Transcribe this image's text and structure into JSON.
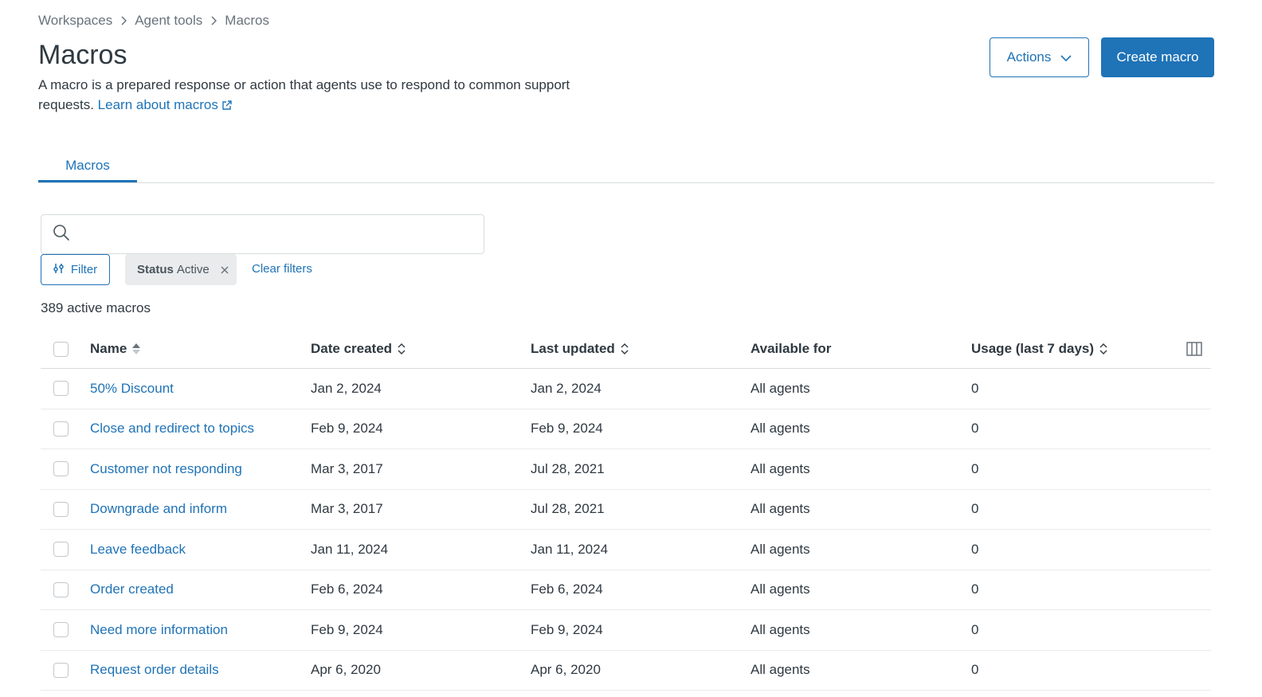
{
  "breadcrumb": {
    "items": [
      "Workspaces",
      "Agent tools",
      "Macros"
    ]
  },
  "header": {
    "title": "Macros",
    "description": "A macro is a prepared response or action that agents use to respond to common support requests.",
    "learn_link": "Learn about macros",
    "actions_label": "Actions",
    "create_label": "Create macro"
  },
  "tabs": [
    {
      "label": "Macros",
      "active": true
    }
  ],
  "search": {
    "value": "",
    "placeholder": ""
  },
  "filters": {
    "filter_label": "Filter",
    "chip_key": "Status",
    "chip_value": "Active",
    "clear_label": "Clear filters"
  },
  "count_text": "389 active macros",
  "table": {
    "headers": {
      "name": "Name",
      "created": "Date created",
      "updated": "Last updated",
      "available": "Available for",
      "usage": "Usage (last 7 days)"
    },
    "rows": [
      {
        "name": "50% Discount",
        "created": "Jan 2, 2024",
        "updated": "Jan 2, 2024",
        "available": "All agents",
        "usage": "0"
      },
      {
        "name": "Close and redirect to topics",
        "created": "Feb 9, 2024",
        "updated": "Feb 9, 2024",
        "available": "All agents",
        "usage": "0"
      },
      {
        "name": "Customer not responding",
        "created": "Mar 3, 2017",
        "updated": "Jul 28, 2021",
        "available": "All agents",
        "usage": "0"
      },
      {
        "name": "Downgrade and inform",
        "created": "Mar 3, 2017",
        "updated": "Jul 28, 2021",
        "available": "All agents",
        "usage": "0"
      },
      {
        "name": "Leave feedback",
        "created": "Jan 11, 2024",
        "updated": "Jan 11, 2024",
        "available": "All agents",
        "usage": "0"
      },
      {
        "name": "Order created",
        "created": "Feb 6, 2024",
        "updated": "Feb 6, 2024",
        "available": "All agents",
        "usage": "0"
      },
      {
        "name": "Need more information",
        "created": "Feb 9, 2024",
        "updated": "Feb 9, 2024",
        "available": "All agents",
        "usage": "0"
      },
      {
        "name": "Request order details",
        "created": "Apr 6, 2020",
        "updated": "Apr 6, 2020",
        "available": "All agents",
        "usage": "0"
      }
    ]
  },
  "colors": {
    "primary": "#1f73b7",
    "text": "#2f3941",
    "muted": "#68737d",
    "border": "#d8dcde",
    "chip_bg": "#e9ebed"
  },
  "icons": [
    "chevron-right-icon",
    "external-link-icon",
    "chevron-down-icon",
    "search-icon",
    "filter-icon",
    "close-icon",
    "sort-ascending-icon",
    "sort-icon",
    "columns-icon"
  ]
}
